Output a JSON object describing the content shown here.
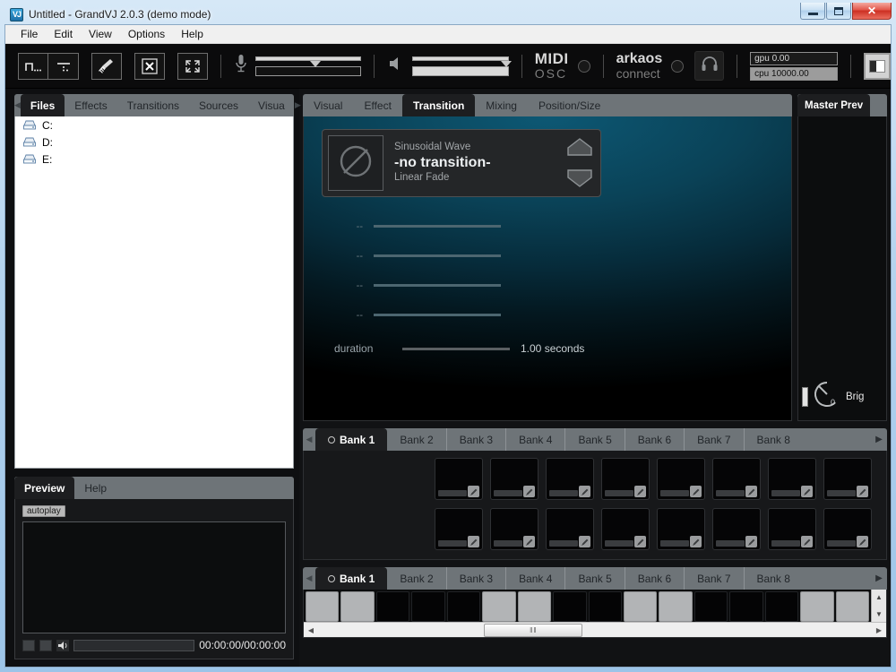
{
  "window": {
    "title": "Untitled - GrandVJ 2.0.3  (demo mode)",
    "app_icon": "VJ",
    "minimize_label": "Minimize",
    "maximize_label": "Maximize",
    "close_label": "✕"
  },
  "menubar": {
    "items": [
      "File",
      "Edit",
      "View",
      "Options",
      "Help"
    ]
  },
  "toolbar": {
    "buttons": [
      {
        "name": "step-mode-button",
        "icon": "step-icon"
      },
      {
        "name": "dots-mode-button",
        "icon": "dots-icon"
      },
      {
        "name": "clear-button",
        "icon": "broom-icon"
      },
      {
        "name": "kill-button",
        "icon": "x-box-icon"
      },
      {
        "name": "fullscreen-button",
        "icon": "fullscreen-icon"
      }
    ],
    "mic": {
      "name": "mic-icon",
      "level": 55,
      "meter": 0
    },
    "speaker": {
      "name": "speaker-icon",
      "level": 100,
      "meter": 100
    },
    "midi": {
      "line1": "MIDI",
      "line2": "OSC"
    },
    "arkaos": {
      "line1": "arkaos",
      "line2": "connect"
    },
    "headphone_icon": "headphone-icon",
    "stats": {
      "gpu": "gpu 0.00",
      "cpu": "cpu 10000.00"
    },
    "layout_button": "layout-icon"
  },
  "left_panel": {
    "tabs": [
      {
        "label": "Files",
        "active": true
      },
      {
        "label": "Effects",
        "active": false
      },
      {
        "label": "Transitions",
        "active": false
      },
      {
        "label": "Sources",
        "active": false
      },
      {
        "label": "Visua",
        "active": false
      }
    ],
    "prev_arrow": "◀",
    "next_arrow": "▶",
    "files": [
      {
        "label": "C:",
        "icon": "drive-icon"
      },
      {
        "label": "D:",
        "icon": "drive-icon"
      },
      {
        "label": "E:",
        "icon": "drive-icon"
      }
    ]
  },
  "preview_panel": {
    "tabs": [
      {
        "label": "Preview",
        "active": true
      },
      {
        "label": "Help",
        "active": false
      }
    ],
    "autoplay_label": "autoplay",
    "timecode": "00:00:00/00:00:00",
    "controls": [
      {
        "name": "pause-button",
        "icon": "pause-icon"
      },
      {
        "name": "stop-button",
        "icon": "stop-icon"
      },
      {
        "name": "volume-button",
        "icon": "speaker-icon"
      }
    ]
  },
  "mix_panel": {
    "tabs": [
      {
        "label": "Visual",
        "active": false
      },
      {
        "label": "Effect",
        "active": false
      },
      {
        "label": "Transition",
        "active": true
      },
      {
        "label": "Mixing",
        "active": false
      },
      {
        "label": "Position/Size",
        "active": false
      }
    ],
    "transition_card": {
      "category": "Sinusoidal Wave",
      "name": "-no transition-",
      "mode": "Linear Fade",
      "thumb_icon": "no-transition-icon",
      "up_button": "chevron-up-icon",
      "down_button": "chevron-down-icon"
    },
    "params": [
      {
        "label": "--",
        "value": 100
      },
      {
        "label": "--",
        "value": 100
      },
      {
        "label": "--",
        "value": 100
      },
      {
        "label": "--",
        "value": 100
      }
    ],
    "duration": {
      "label": "duration",
      "value": "1.00 seconds"
    }
  },
  "master_panel": {
    "tab_label": "Master Prev",
    "brightness": {
      "label": "Brig",
      "value": "0"
    }
  },
  "bank_visuals": {
    "tabs": [
      {
        "label": "Bank 1",
        "active": true
      },
      {
        "label": "Bank 2",
        "active": false
      },
      {
        "label": "Bank 3",
        "active": false
      },
      {
        "label": "Bank 4",
        "active": false
      },
      {
        "label": "Bank 5",
        "active": false
      },
      {
        "label": "Bank 6",
        "active": false
      },
      {
        "label": "Bank 7",
        "active": false
      },
      {
        "label": "Bank 8",
        "active": false
      }
    ],
    "next_arrow": "▶",
    "prev_arrow": "◀",
    "rows": 2,
    "cols": 8
  },
  "bank_keys": {
    "tabs": [
      {
        "label": "Bank 1",
        "active": true
      },
      {
        "label": "Bank 2",
        "active": false
      },
      {
        "label": "Bank 3",
        "active": false
      },
      {
        "label": "Bank 4",
        "active": false
      },
      {
        "label": "Bank 5",
        "active": false
      },
      {
        "label": "Bank 6",
        "active": false
      },
      {
        "label": "Bank 7",
        "active": false
      },
      {
        "label": "Bank 8",
        "active": false
      }
    ],
    "next_arrow": "▶",
    "prev_arrow": "◀",
    "keys": [
      1,
      1,
      0,
      0,
      0,
      1,
      1,
      0,
      0,
      1,
      1,
      0,
      0,
      0,
      1,
      1
    ],
    "scroll_up": "▲",
    "scroll_down": "▼",
    "scroll_left": "◀",
    "scroll_right": "▶",
    "thumb_grip": "‖‖"
  },
  "colors": {
    "accent": "#0d5874",
    "tabstrip": "#6e7478",
    "panel_dark": "#17181a",
    "titlebar": "#9cc4e8"
  }
}
